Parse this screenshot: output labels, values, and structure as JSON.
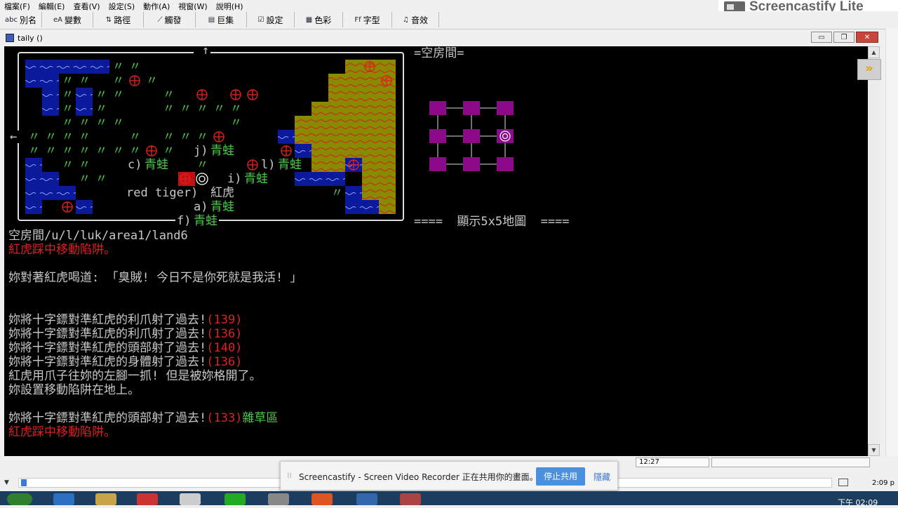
{
  "menu": [
    "檔案(F)",
    "編輯(E)",
    "查看(V)",
    "設定(S)",
    "動作(A)",
    "視窗(W)",
    "說明(H)"
  ],
  "toolbar": [
    {
      "icon": "abc",
      "label": "別名"
    },
    {
      "icon": "eA",
      "label": "變數"
    },
    {
      "icon": "⇅",
      "label": "路徑"
    },
    {
      "icon": "⟋",
      "label": "觸發"
    },
    {
      "icon": "▤",
      "label": "巨集"
    },
    {
      "icon": "☑",
      "label": "設定"
    },
    {
      "icon": "▦",
      "label": "色彩"
    },
    {
      "icon": "Ff",
      "label": "字型"
    },
    {
      "icon": "♫",
      "label": "音效"
    }
  ],
  "watermark": "Screencastify Lite",
  "window_title": "taily ()",
  "window_buttons": {
    "minimize": "▭",
    "restore": "❐",
    "close": "✕"
  },
  "room": {
    "title": "=空房間=",
    "map_caption": "====  顯示5x5地圖  ===="
  },
  "map_labels": {
    "j": "j)",
    "c": "c)",
    "l": "l)",
    "i": "i)",
    "red_tiger": "red tiger)",
    "a": "a)",
    "f": "f)",
    "frog": "青蛙",
    "tiger": "紅虎",
    "up_arrow": "↑",
    "left_arrow": "←",
    "water": "~",
    "grass": "〃"
  },
  "log": {
    "path": "空房間/u/l/luk/area1/land6",
    "trap1": "紅虎踩中移動陷阱。",
    "shout": "妳對著紅虎喝道: 「臭賊! 今日不是你死就是我活! 」",
    "shots": [
      {
        "text": "妳將十字鏢對準紅虎的利爪射了過去!",
        "dmg": "(139)"
      },
      {
        "text": "妳將十字鏢對準紅虎的利爪射了過去!",
        "dmg": "(136)"
      },
      {
        "text": "妳將十字鏢對準紅虎的頭部射了過去!",
        "dmg": "(140)"
      },
      {
        "text": "妳將十字鏢對準紅虎的身體射了過去!",
        "dmg": "(136)"
      }
    ],
    "claw": "紅虎用爪子往妳的左腳一抓! 但是被妳格開了。",
    "set_trap": "妳設置移動陷阱在地上。",
    "last_shot": {
      "text": "妳將十字鏢對準紅虎的頭部射了過去!",
      "dmg": "(133)",
      "area": "雜草區"
    },
    "trap2": "紅虎踩中移動陷阱。"
  },
  "status": {
    "time": "12:27"
  },
  "input": {
    "value": ""
  },
  "share": {
    "grip": "⁞⁞",
    "message": "Screencastify - Screen Video Recorder 正在共用你的畫面。",
    "stop_label": "停止共用",
    "hide_label": "隱藏"
  },
  "taskbar": {
    "clock": "下午 02:09",
    "side_time": "2:09 p"
  },
  "colors": {
    "terminal_bg": "#000000",
    "water": "#0a1a9a",
    "sand": "#8a8a00",
    "wave_red": "#d02020",
    "trap": "#e02020",
    "frog_green": "#4ec94e",
    "map_node": "#8a0a8a",
    "accent": "#4a8fe0"
  }
}
